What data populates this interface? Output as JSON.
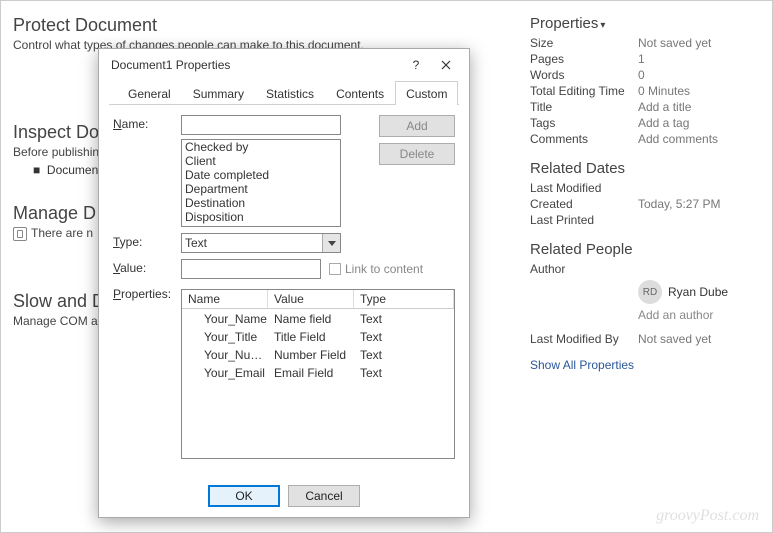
{
  "left": {
    "protect": {
      "title": "Protect Document",
      "sub": "Control what types of changes people can make to this document."
    },
    "inspect": {
      "title": "Inspect Do",
      "sub": "Before publishin",
      "bullet": "Document p"
    },
    "manage": {
      "title": "Manage D",
      "sub": "There are n"
    },
    "addins": {
      "title": "Slow and D",
      "sub": "Manage COM ad"
    }
  },
  "right": {
    "propsTitle": "Properties",
    "props": {
      "Size": "Not saved yet",
      "Pages": "1",
      "Words": "0",
      "Total Editing Time": "0 Minutes",
      "Title": "Add a title",
      "Tags": "Add a tag",
      "Comments": "Add comments"
    },
    "datesTitle": "Related Dates",
    "dates": {
      "Last Modified": "",
      "Created": "Today, 5:27 PM",
      "Last Printed": ""
    },
    "peopleTitle": "Related People",
    "authorLabel": "Author",
    "author": {
      "initials": "RD",
      "name": "Ryan Dube"
    },
    "addAuthor": "Add an author",
    "lastModByLabel": "Last Modified By",
    "lastModBy": "Not saved yet",
    "showAll": "Show All Properties"
  },
  "dialog": {
    "title": "Document1 Properties",
    "tabs": [
      "General",
      "Summary",
      "Statistics",
      "Contents",
      "Custom"
    ],
    "activeTab": 4,
    "nameLabel": "Name:",
    "typeLabel": "Type:",
    "valueLabel": "Value:",
    "propsLabel": "Properties:",
    "typeValue": "Text",
    "linkLabel": "Link to content",
    "addBtn": "Add",
    "delBtn": "Delete",
    "okBtn": "OK",
    "cancelBtn": "Cancel",
    "listItems": [
      "Checked by",
      "Client",
      "Date completed",
      "Department",
      "Destination",
      "Disposition"
    ],
    "tableHead": [
      "Name",
      "Value",
      "Type"
    ],
    "tableRows": [
      {
        "n": "Your_Name",
        "v": "Name field",
        "t": "Text"
      },
      {
        "n": "Your_Title",
        "v": "Title Field",
        "t": "Text"
      },
      {
        "n": "Your_Nu…",
        "v": "Number Field",
        "t": "Text"
      },
      {
        "n": "Your_Email",
        "v": "Email Field",
        "t": "Text"
      }
    ]
  },
  "watermark": "groovyPost.com"
}
